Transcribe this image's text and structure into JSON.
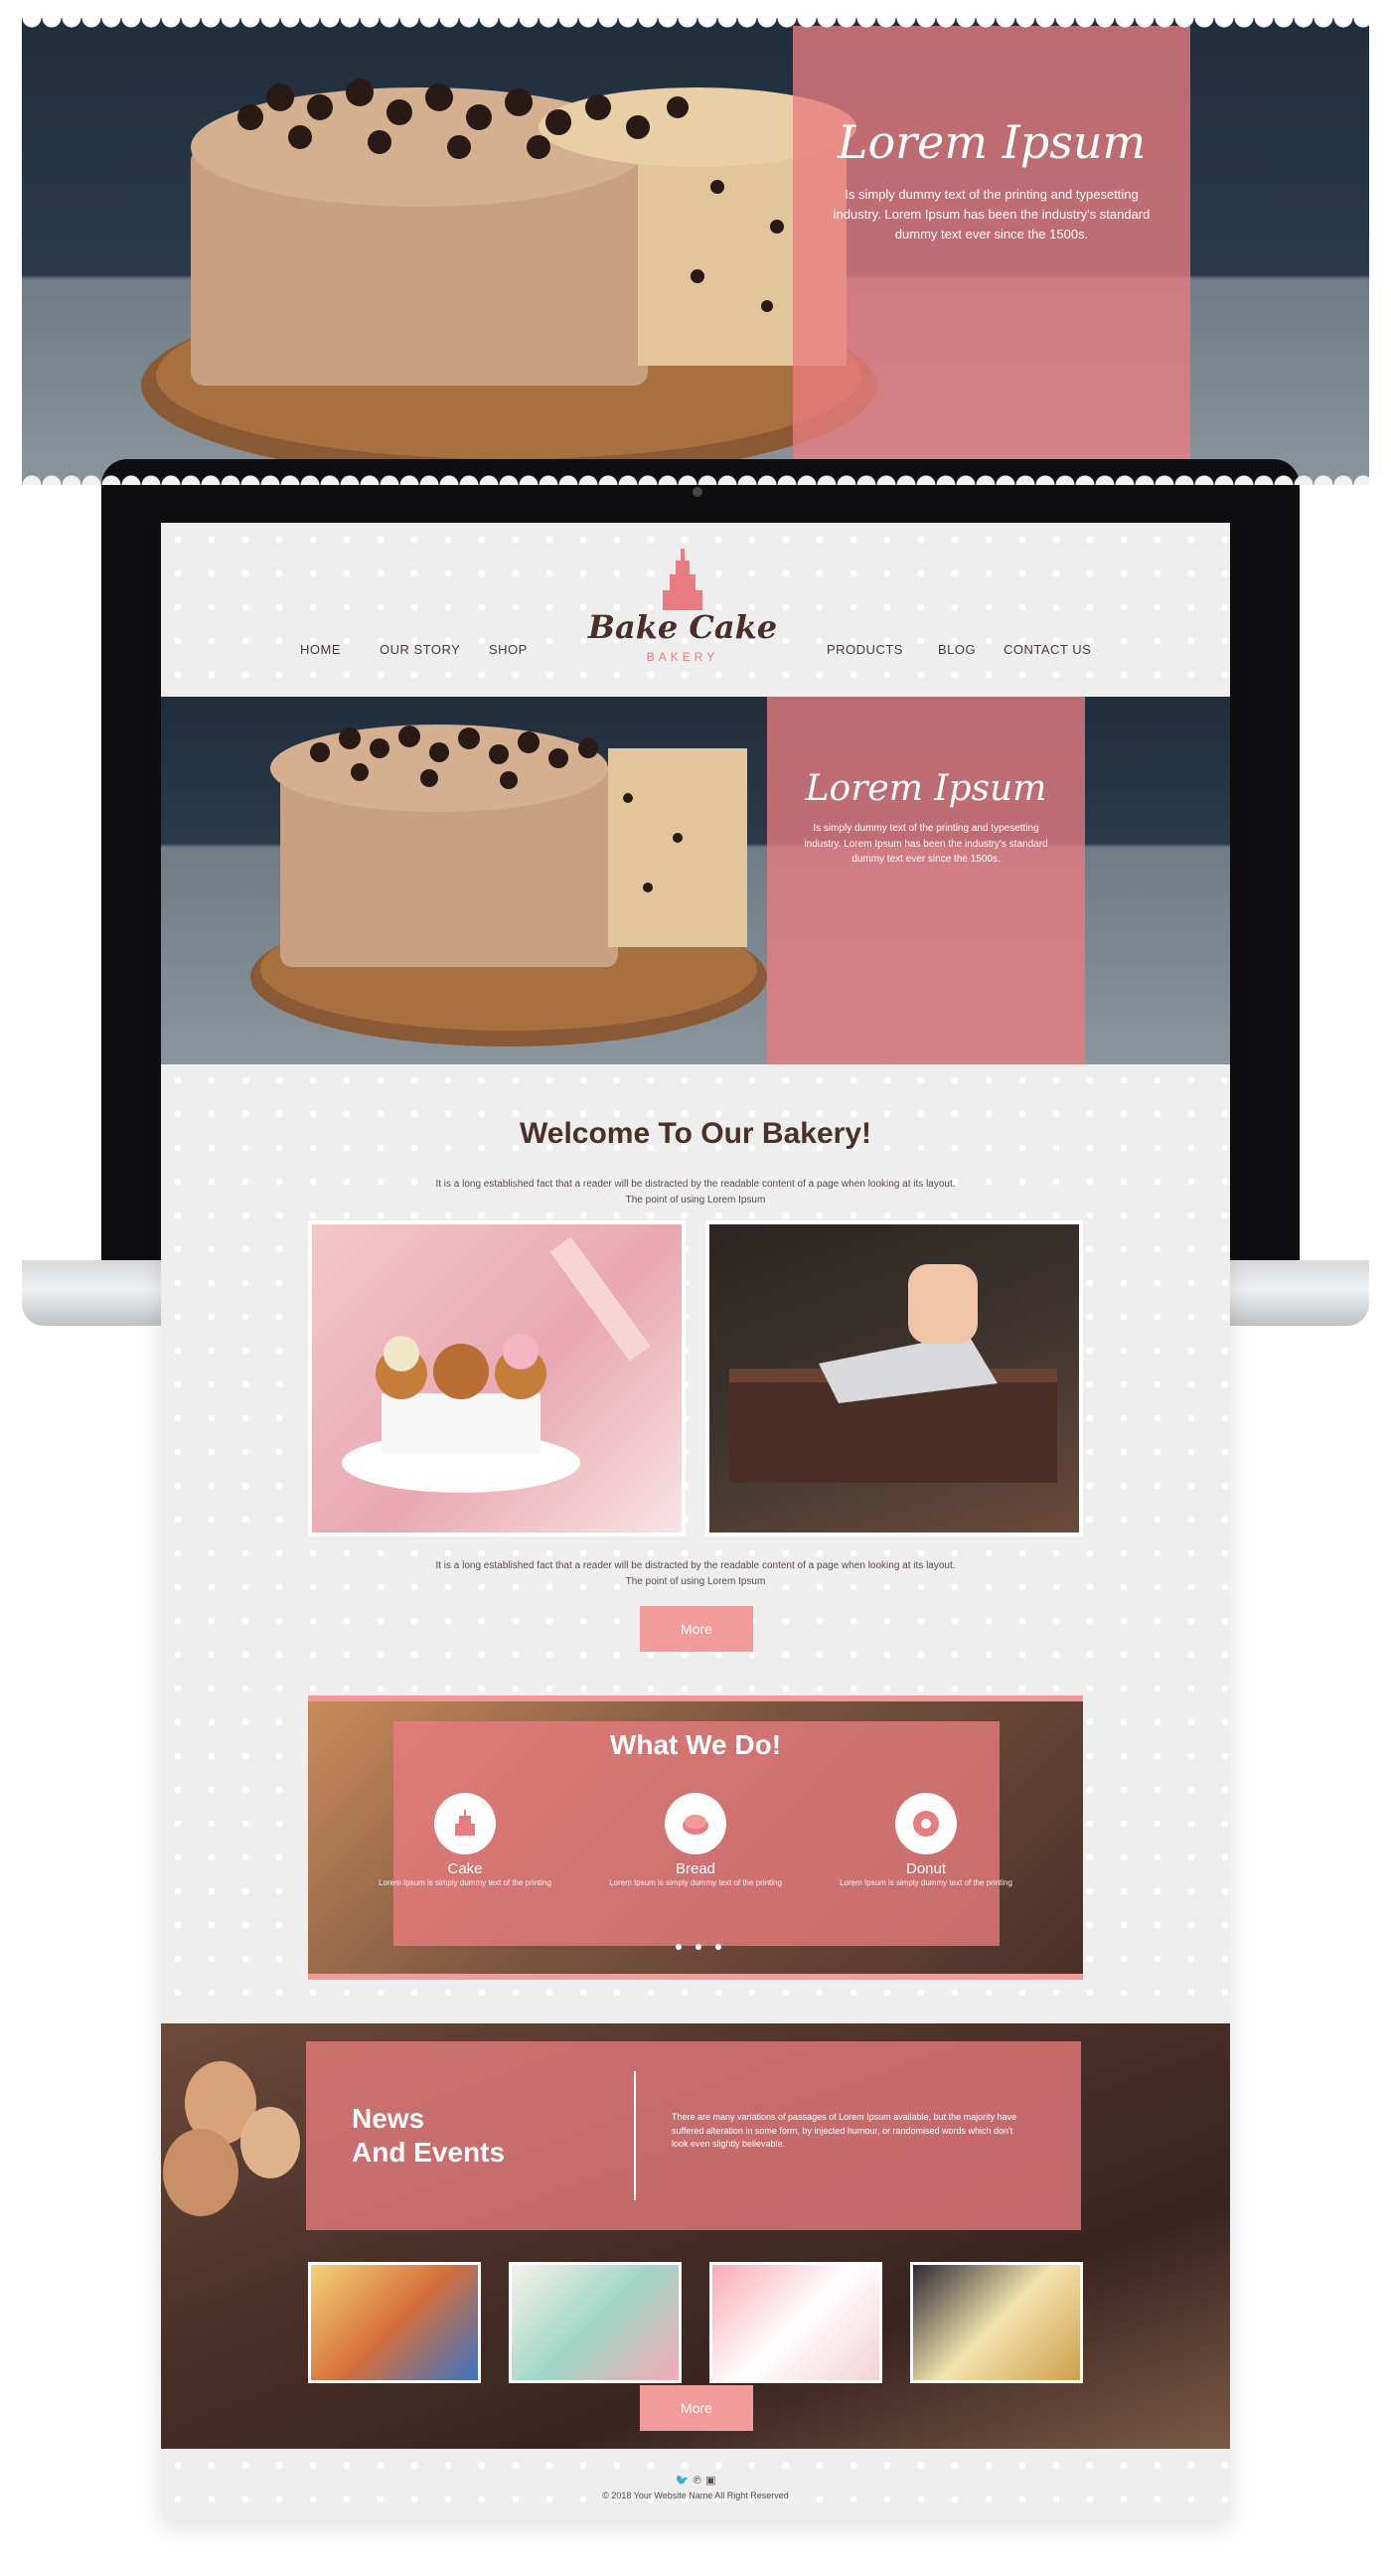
{
  "hero_top": {
    "title": "Lorem Ipsum",
    "desc": "Is simply dummy text of the printing and typesetting industry. Lorem Ipsum has been the industry's standard dummy text ever since the 1500s."
  },
  "site": {
    "nav_left": [
      "HOME",
      "OUR STORY",
      "SHOP"
    ],
    "nav_right": [
      "PRODUCTS",
      "BLOG",
      "CONTACT US"
    ],
    "logo_name": "Bake Cake",
    "logo_sub": "BAKERY",
    "hero": {
      "title": "Lorem Ipsum",
      "desc": "Is simply dummy text of the printing and typesetting industry. Lorem Ipsum has been the industry's standard dummy text ever since the 1500s."
    },
    "welcome": {
      "title": "Welcome To Our Bakery!",
      "intro_line1": "It is a long established fact that a reader will be distracted by the readable content of a page when looking at its layout.",
      "intro_line2": "The point of using Lorem Ipsum",
      "outro_line1": "It is a long established fact that a reader will be distracted by the readable content of a page when looking at its layout.",
      "outro_line2": "The point of using Lorem Ipsum",
      "more_label": "More"
    },
    "what_we_do": {
      "title": "What We Do!",
      "services": [
        {
          "name": "Cake",
          "icon": "cake-icon",
          "desc": "Lorem Ipsum is simply dummy text of the printing"
        },
        {
          "name": "Bread",
          "icon": "bread-icon",
          "desc": "Lorem Ipsum is simply dummy text of the printing"
        },
        {
          "name": "Donut",
          "icon": "donut-icon",
          "desc": "Lorem Ipsum is simply dummy text of the printing"
        }
      ]
    },
    "news": {
      "title_line1": "News",
      "title_line2": "And Events",
      "desc": "There are many variations of passages of Lorem Ipsum available, but the majority have suffered alteration in some form, by injected humour, or randomised words which don't look even slightly believable.",
      "more_label": "More"
    },
    "footer": {
      "social_icons": [
        "twitter-icon",
        "pinterest-icon",
        "instagram-icon"
      ],
      "copyright": "© 2018 Your Website Name All Right Reserved"
    }
  },
  "colors": {
    "accent_pink": "#e97c80",
    "button_pink": "#f29b9b",
    "text_brown": "#4a3028"
  }
}
